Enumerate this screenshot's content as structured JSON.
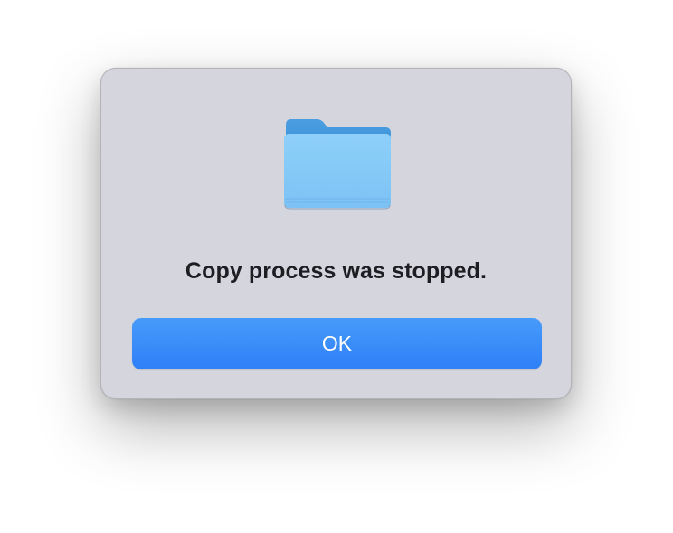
{
  "dialog": {
    "icon": "folder-icon",
    "message": "Copy process was stopped.",
    "ok_label": "OK"
  },
  "colors": {
    "dialog_background": "#d5d5dd",
    "button_accent": "#3486f8",
    "folder_blue": "#87cbf8",
    "message_text": "#1e1e22"
  }
}
